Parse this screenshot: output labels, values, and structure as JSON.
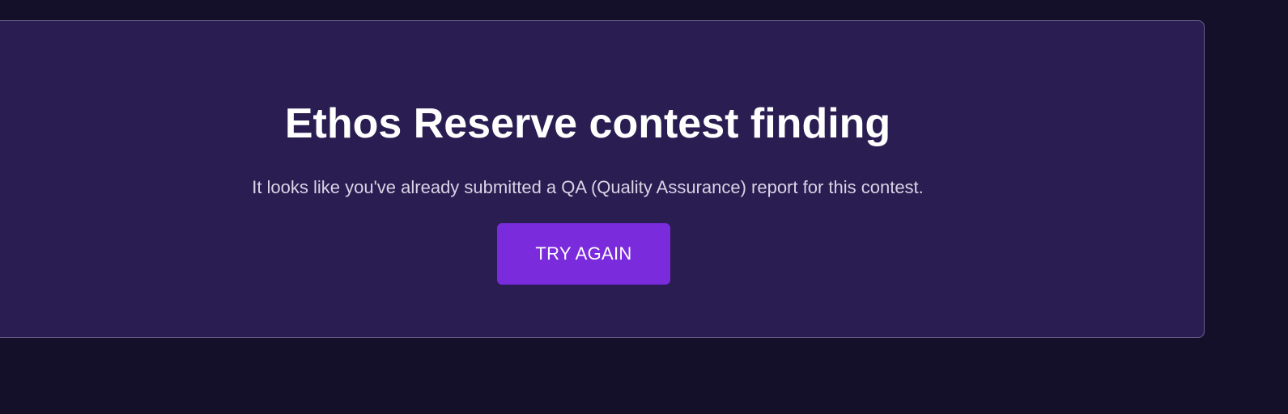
{
  "card": {
    "title": "Ethos Reserve contest finding",
    "message": "It looks like you've already submitted a QA (Quality Assurance) report for this contest.",
    "button_label": "TRY AGAIN"
  },
  "colors": {
    "page_background": "#15102a",
    "card_background": "#291d51",
    "card_border": "#6a5e8e",
    "button_background": "#7a2bdc",
    "title_text": "#ffffff",
    "message_text": "#d9d4e6"
  }
}
